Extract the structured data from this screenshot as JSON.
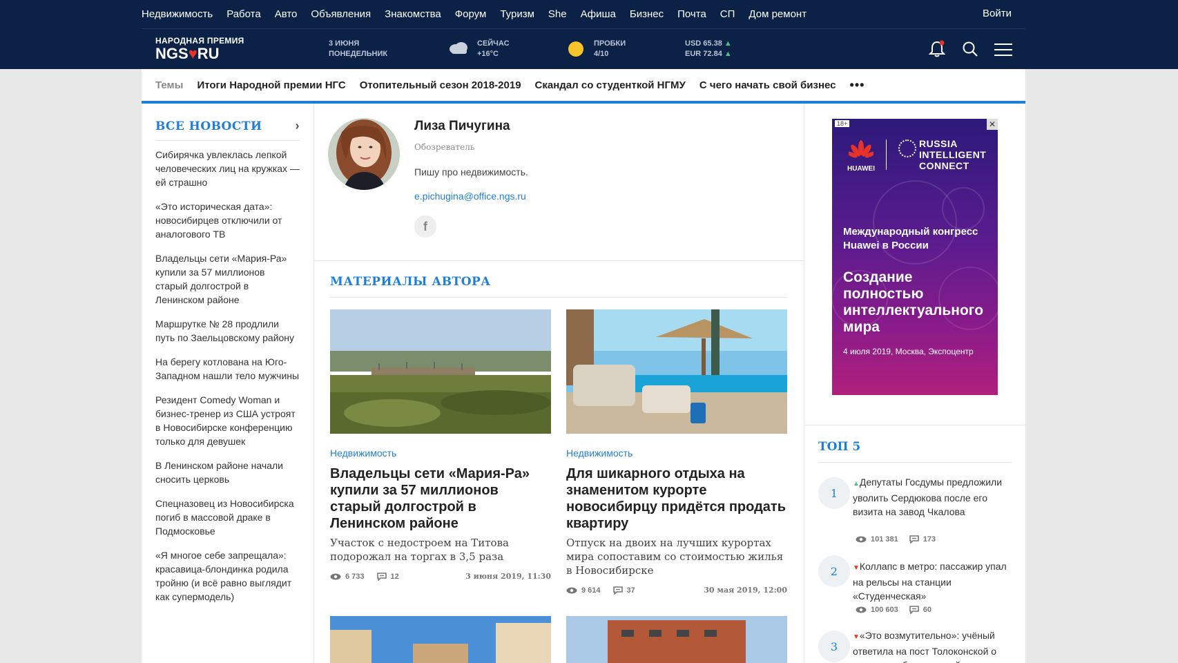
{
  "nav": {
    "items": [
      "Недвижимость",
      "Работа",
      "Авто",
      "Объявления",
      "Знакомства",
      "Форум",
      "Туризм",
      "She",
      "Афиша",
      "Бизнес",
      "Почта",
      "СП",
      "Дом ремонт"
    ],
    "login": "Войти"
  },
  "logo": {
    "small": "НАРОДНАЯ ПРЕМИЯ",
    "ngs": "NGS",
    "ru": "RU"
  },
  "info": {
    "date_line1": "3 июня",
    "date_line2": "понедельник",
    "weather_line1": "Сейчас",
    "weather_line2": "+16°C",
    "traffic_line1": "Пробки",
    "traffic_line2": "4/10",
    "usd": "USD 65.38",
    "eur": "EUR 72.84",
    "arrow": "▲"
  },
  "themes": {
    "label": "Темы",
    "items": [
      "Итоги Народной премии НГС",
      "Отопительный сезон 2018-2019",
      "Скандал со студенткой НГМУ",
      "С чего начать свой бизнес"
    ],
    "more": "•••"
  },
  "left": {
    "title": "ВСЕ НОВОСТИ",
    "chevron": "›",
    "news": [
      "Сибирячка увлеклась лепкой человеческих лиц на кружках — ей страшно",
      "«Это историческая дата»: новосибирцев отключили от аналогового ТВ",
      "Владельцы сети «Мария-Ра» купили за 57 миллионов старый долгострой в Ленинском районе",
      "Маршрутке № 28 продлили путь по Заельцовскому району",
      "На берегу котлована на Юго-Западном нашли тело мужчины",
      "Резидент Comedy Woman и бизнес-тренер из США устроят в Новосибирске конференцию только для девушек",
      "В Ленинском районе начали сносить церковь",
      "Спецназовец из Новосибирска погиб в массовой драке в Подмосковье",
      "«Я многое себе запрещала»: красавица-блондинка родила тройню (и всё равно выглядит как супермодель)"
    ]
  },
  "author": {
    "name": "Лиза Пичугина",
    "role": "Обозреватель",
    "desc": "Пишу про недвижимость.",
    "email": "e.pichugina@office.ngs.ru",
    "fb": "f"
  },
  "materials": {
    "title": "МАТЕРИАЛЫ АВТОРА",
    "cards": [
      {
        "rubric": "Недвижимость",
        "title": "Владельцы сети «Мария-Ра» купили за 57 миллионов старый долгострой в Ленинском районе",
        "sub": "Участок с недостроем на Титова подорожал на торгах в 3,5 раза",
        "views": "6 733",
        "comments": "12",
        "date": "3 июня 2019, 11:30"
      },
      {
        "rubric": "Недвижимость",
        "title": "Для шикарного отдыха на знаменитом курорте новосибирцу придётся продать квартиру",
        "sub": "Отпуск на двоих на лучших курортах мира сопоставим со стоимостью жилья в Новосибирске",
        "views": "9 614",
        "comments": "37",
        "date": "30 мая 2019, 12:00"
      }
    ]
  },
  "ad": {
    "age": "18+",
    "close": "✕",
    "brand": "HUAWEI",
    "ric": [
      "RUSSIA",
      "INTELLIGENT",
      "CONNECT"
    ],
    "congress": "Международный конгресс Huawei в России",
    "headline": "Создание полностью интеллектуального мира",
    "date": "4 июля 2019, Москва, Экспоцентр"
  },
  "top5": {
    "title": "ТОП 5",
    "items": [
      {
        "num": "1",
        "trend": "▲",
        "text": "Депутаты Госдумы предложили уволить Сердюкова после его визита на завод Чкалова",
        "views": "101 381",
        "comments": "173"
      },
      {
        "num": "2",
        "trend": "▼",
        "text": "Коллапс в метро: пассажир упал на рельсы на станции «Студенческая»",
        "views": "100 603",
        "comments": "60"
      },
      {
        "num": "3",
        "trend": "▼",
        "text": "«Это возмутительно»: учёный ответила на пост Толоконской о том, что сибиряки устойчивы к радиации",
        "views": "",
        "comments": ""
      }
    ]
  },
  "colors": {
    "topbar": "#0b2145",
    "accent": "#1f7fd8",
    "up": "#4ec37f",
    "down": "#e6332a"
  }
}
